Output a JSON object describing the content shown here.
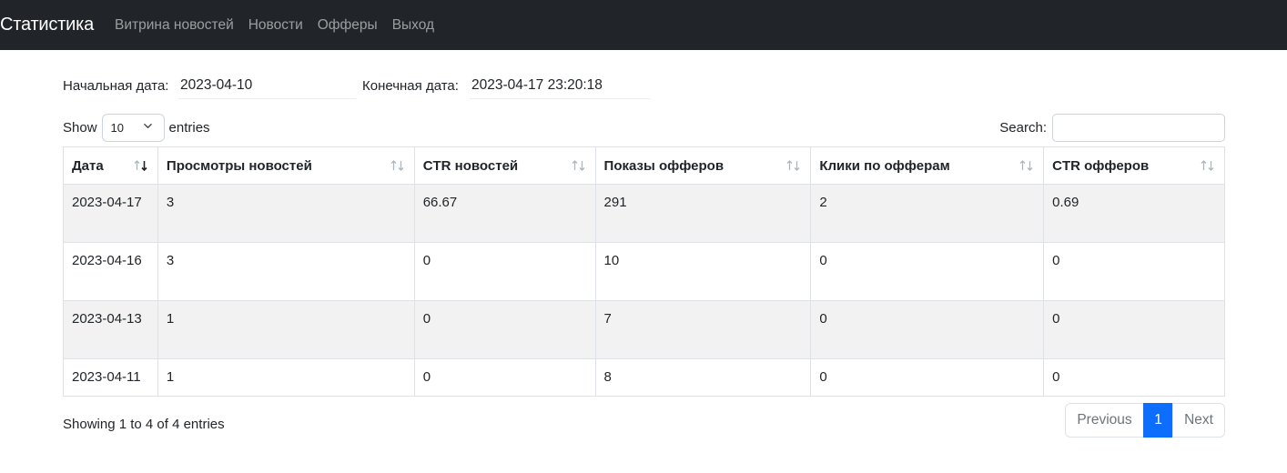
{
  "navbar": {
    "brand": "Статистика",
    "links": [
      "Витрина новостей",
      "Новости",
      "Офферы",
      "Выход"
    ]
  },
  "filters": {
    "start_label": "Начальная дата:",
    "start_value": "2023-04-10",
    "end_label": "Конечная дата:",
    "end_value": "2023-04-17 23:20:18"
  },
  "length": {
    "show_label": "Show",
    "value": "10",
    "entries_label": "entries"
  },
  "search": {
    "label": "Search:",
    "value": ""
  },
  "table": {
    "columns": [
      "Дата",
      "Просмотры новостей",
      "CTR новостей",
      "Показы офферов",
      "Клики по офферам",
      "CTR офферов"
    ],
    "rows": [
      [
        "2023-04-17",
        "3",
        "66.67",
        "291",
        "2",
        "0.69"
      ],
      [
        "2023-04-16",
        "3",
        "0",
        "10",
        "0",
        "0"
      ],
      [
        "2023-04-13",
        "1",
        "0",
        "7",
        "0",
        "0"
      ],
      [
        "2023-04-11",
        "1",
        "0",
        "8",
        "0",
        "0"
      ]
    ]
  },
  "info": "Showing 1 to 4 of 4 entries",
  "pagination": {
    "previous": "Previous",
    "current": "1",
    "next": "Next"
  },
  "colors": {
    "navbar": "#212529",
    "active_page": "#0d6efd",
    "stripe": "#f2f2f2"
  }
}
